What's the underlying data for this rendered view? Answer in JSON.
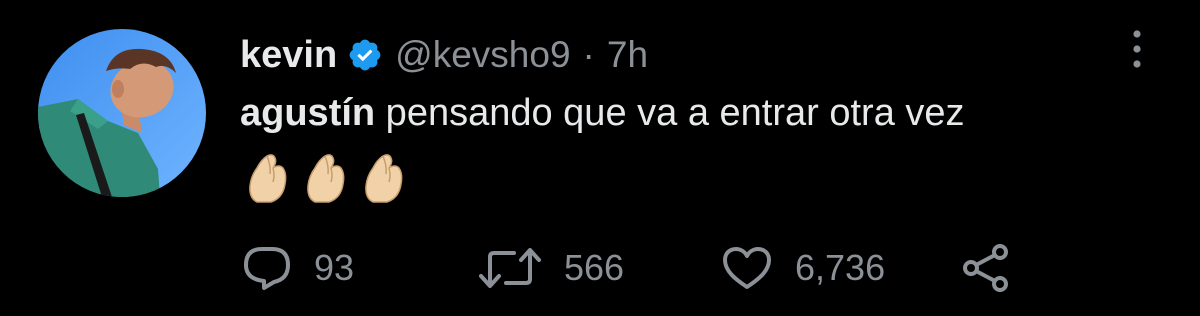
{
  "tweet": {
    "author": {
      "display_name": "kevin",
      "verified": true,
      "handle": "@kevsho9",
      "separator": "·",
      "time": "7h"
    },
    "text": {
      "mention": "agustín",
      "body": " pensando que va a entrar otra vez"
    },
    "emojis": [
      "pinched-fingers",
      "pinched-fingers",
      "pinched-fingers"
    ],
    "actions": {
      "reply_count": "93",
      "retweet_count": "566",
      "like_count": "6,736"
    }
  },
  "colors": {
    "background": "#000000",
    "primary_text": "#e7e9ea",
    "secondary_text": "#8b9197",
    "verified_badge": "#1d9bf0"
  },
  "icons": [
    "more-vertical-icon",
    "verified-badge-icon",
    "reply-icon",
    "retweet-icon",
    "like-icon",
    "share-icon"
  ]
}
